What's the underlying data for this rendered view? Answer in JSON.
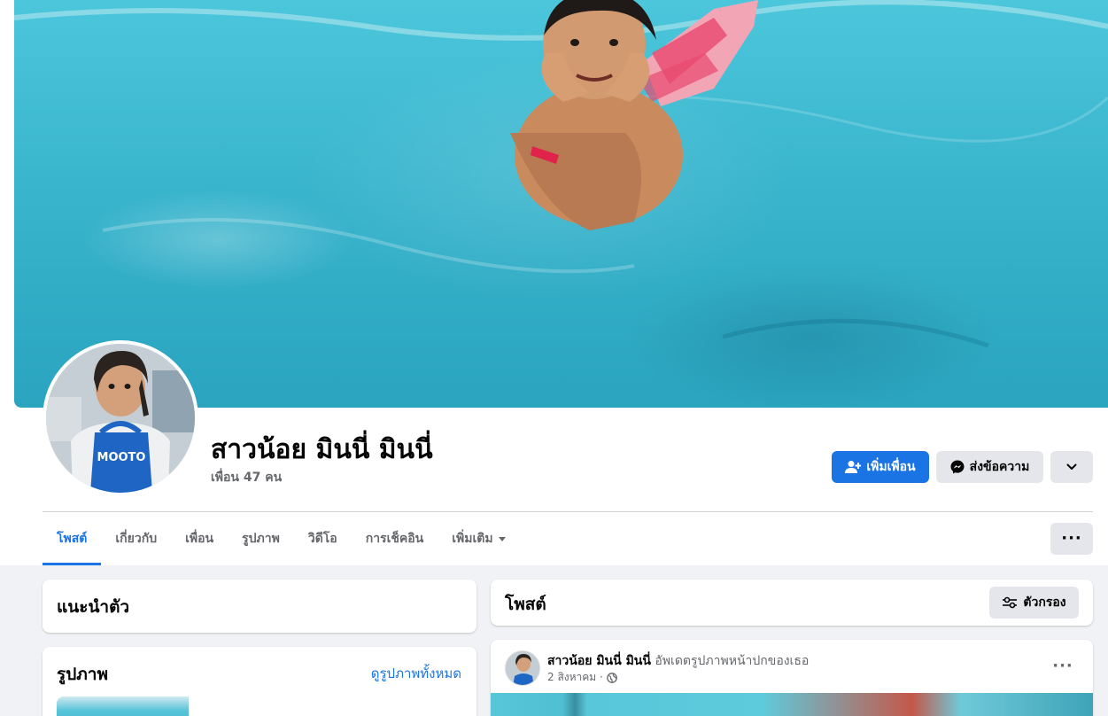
{
  "profile": {
    "name": "สาวน้อย มินนี่ มินนี่",
    "friends_count": "เพื่อน 47 คน"
  },
  "actions": {
    "add_friend": "เพิ่มเพื่อน",
    "message": "ส่งข้อความ"
  },
  "tabs": [
    {
      "label": "โพสต์",
      "active": true
    },
    {
      "label": "เกี่ยวกับ"
    },
    {
      "label": "เพื่อน"
    },
    {
      "label": "รูปภาพ"
    },
    {
      "label": "วิดีโอ"
    },
    {
      "label": "การเช็คอิน"
    },
    {
      "label": "เพิ่มเติม"
    }
  ],
  "intro": {
    "title": "แนะนำตัว"
  },
  "photos": {
    "title": "รูปภาพ",
    "see_all": "ดูรูปภาพทั้งหมด"
  },
  "posts_header": {
    "title": "โพสต์",
    "filter": "ตัวกรอง"
  },
  "post": {
    "author": "สาวน้อย มินนี่ มินนี่",
    "action": "อัพเดตรูปภาพหน้าปกของเธอ",
    "date": "2 สิงหาคม ·"
  },
  "avatar_text": "MOOTO",
  "colors": {
    "accent": "#1b74e4",
    "background": "#f0f2f5",
    "secondary_button": "#e4e6eb"
  }
}
